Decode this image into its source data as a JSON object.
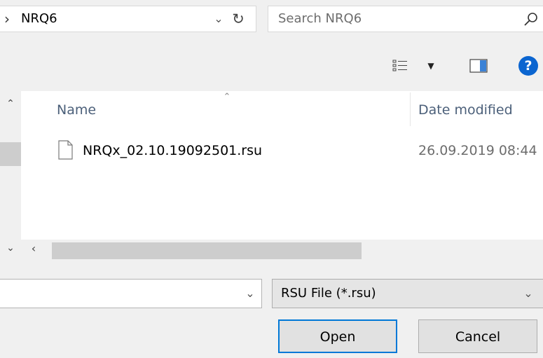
{
  "address": {
    "chevron": "›",
    "path": "NRQ6",
    "dropdown_icon": "chevron-down-icon",
    "refresh_icon": "refresh-icon"
  },
  "search": {
    "placeholder": "Search NRQ6"
  },
  "toolbar": {
    "view_icon": "view-options-icon",
    "pane_icon": "preview-pane-icon",
    "help_label": "?"
  },
  "list": {
    "columns": [
      "Name",
      "Date modified"
    ],
    "rows": [
      {
        "name": "NRQx_02.10.19092501.rsu",
        "date_modified": "26.09.2019 08:44",
        "icon": "file-icon"
      }
    ]
  },
  "bottom": {
    "filename_value": "",
    "file_type": "RSU File (*.rsu)",
    "open_label": "Open",
    "cancel_label": "Cancel"
  },
  "colors": {
    "accent": "#0078d7",
    "help": "#0b65d0",
    "header_text": "#4c607a"
  }
}
